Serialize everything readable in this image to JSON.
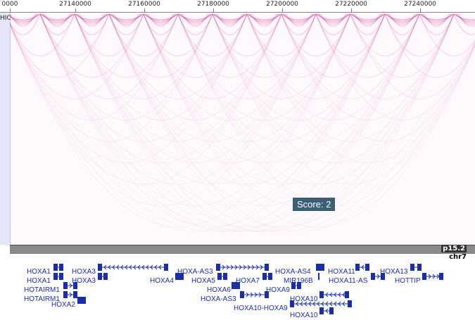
{
  "ruler": {
    "labels": [
      "0000",
      "27140000",
      "27160000",
      "27180000",
      "27200000",
      "27220000",
      "27240000"
    ]
  },
  "hic": {
    "track_label": "HIC",
    "color": "#d63c9c"
  },
  "score_badge": "Score: 2",
  "ideogram": {
    "band": "p15.2",
    "chromosome": "chr7"
  },
  "genes": [
    {
      "name": "HOXA1",
      "strand": "+"
    },
    {
      "name": "HOXA1",
      "strand": "+"
    },
    {
      "name": "HOTAIRM1",
      "strand": "+"
    },
    {
      "name": "HOTAIRM1",
      "strand": "+"
    },
    {
      "name": "HOXA2",
      "strand": "-"
    },
    {
      "name": "HOXA3",
      "strand": "-"
    },
    {
      "name": "HOXA3",
      "strand": "-"
    },
    {
      "name": "HOXA4",
      "strand": "-"
    },
    {
      "name": "HOXA-AS3",
      "strand": "+"
    },
    {
      "name": "HOXA5",
      "strand": "-"
    },
    {
      "name": "HOXA6",
      "strand": "-"
    },
    {
      "name": "HOXA-AS3",
      "strand": "+"
    },
    {
      "name": "HOXA7",
      "strand": "-"
    },
    {
      "name": "HOXA-AS4",
      "strand": "+"
    },
    {
      "name": "MIR196B",
      "strand": "-"
    },
    {
      "name": "HOXA9",
      "strand": "-"
    },
    {
      "name": "HOXA10",
      "strand": "-"
    },
    {
      "name": "HOXA10-HOXA9",
      "strand": "-"
    },
    {
      "name": "HOXA10",
      "strand": "-"
    },
    {
      "name": "HOXA11",
      "strand": "-"
    },
    {
      "name": "HOXA11-AS",
      "strand": "+"
    },
    {
      "name": "HOXA13",
      "strand": "-"
    },
    {
      "name": "HOTTIP",
      "strand": "+"
    }
  ]
}
